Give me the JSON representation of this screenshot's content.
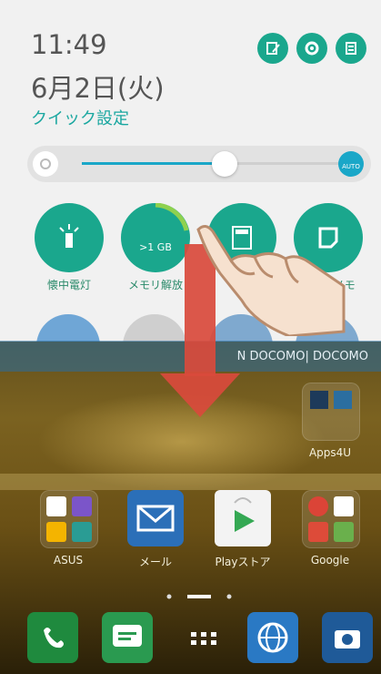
{
  "quick_settings": {
    "time": "11:49",
    "date": "6月2日(火)",
    "label": "クイック設定",
    "brightness_percent": 54,
    "tiles": [
      {
        "label": "懐中電灯"
      },
      {
        "label": "メモリ解放",
        "badge": ">1 GB"
      },
      {
        "label": ""
      },
      {
        "label": "イックメモ"
      }
    ]
  },
  "status_bar": {
    "carrier": "NTT DOCOMO | NTT DOCOMO",
    "carrier_visible": "N        DOCOMO|      DOCOMO"
  },
  "home": {
    "folder_apps4u": "Apps4U",
    "apps": [
      {
        "label": "ASUS"
      },
      {
        "label": "メール"
      },
      {
        "label": "Playストア"
      },
      {
        "label": "Google"
      }
    ],
    "dock": [
      "phone-icon",
      "message-icon",
      "app-drawer-icon",
      "browser-icon",
      "camera-icon"
    ]
  },
  "colors": {
    "accent": "#1aa78d",
    "arrow": "#d94a3c"
  }
}
